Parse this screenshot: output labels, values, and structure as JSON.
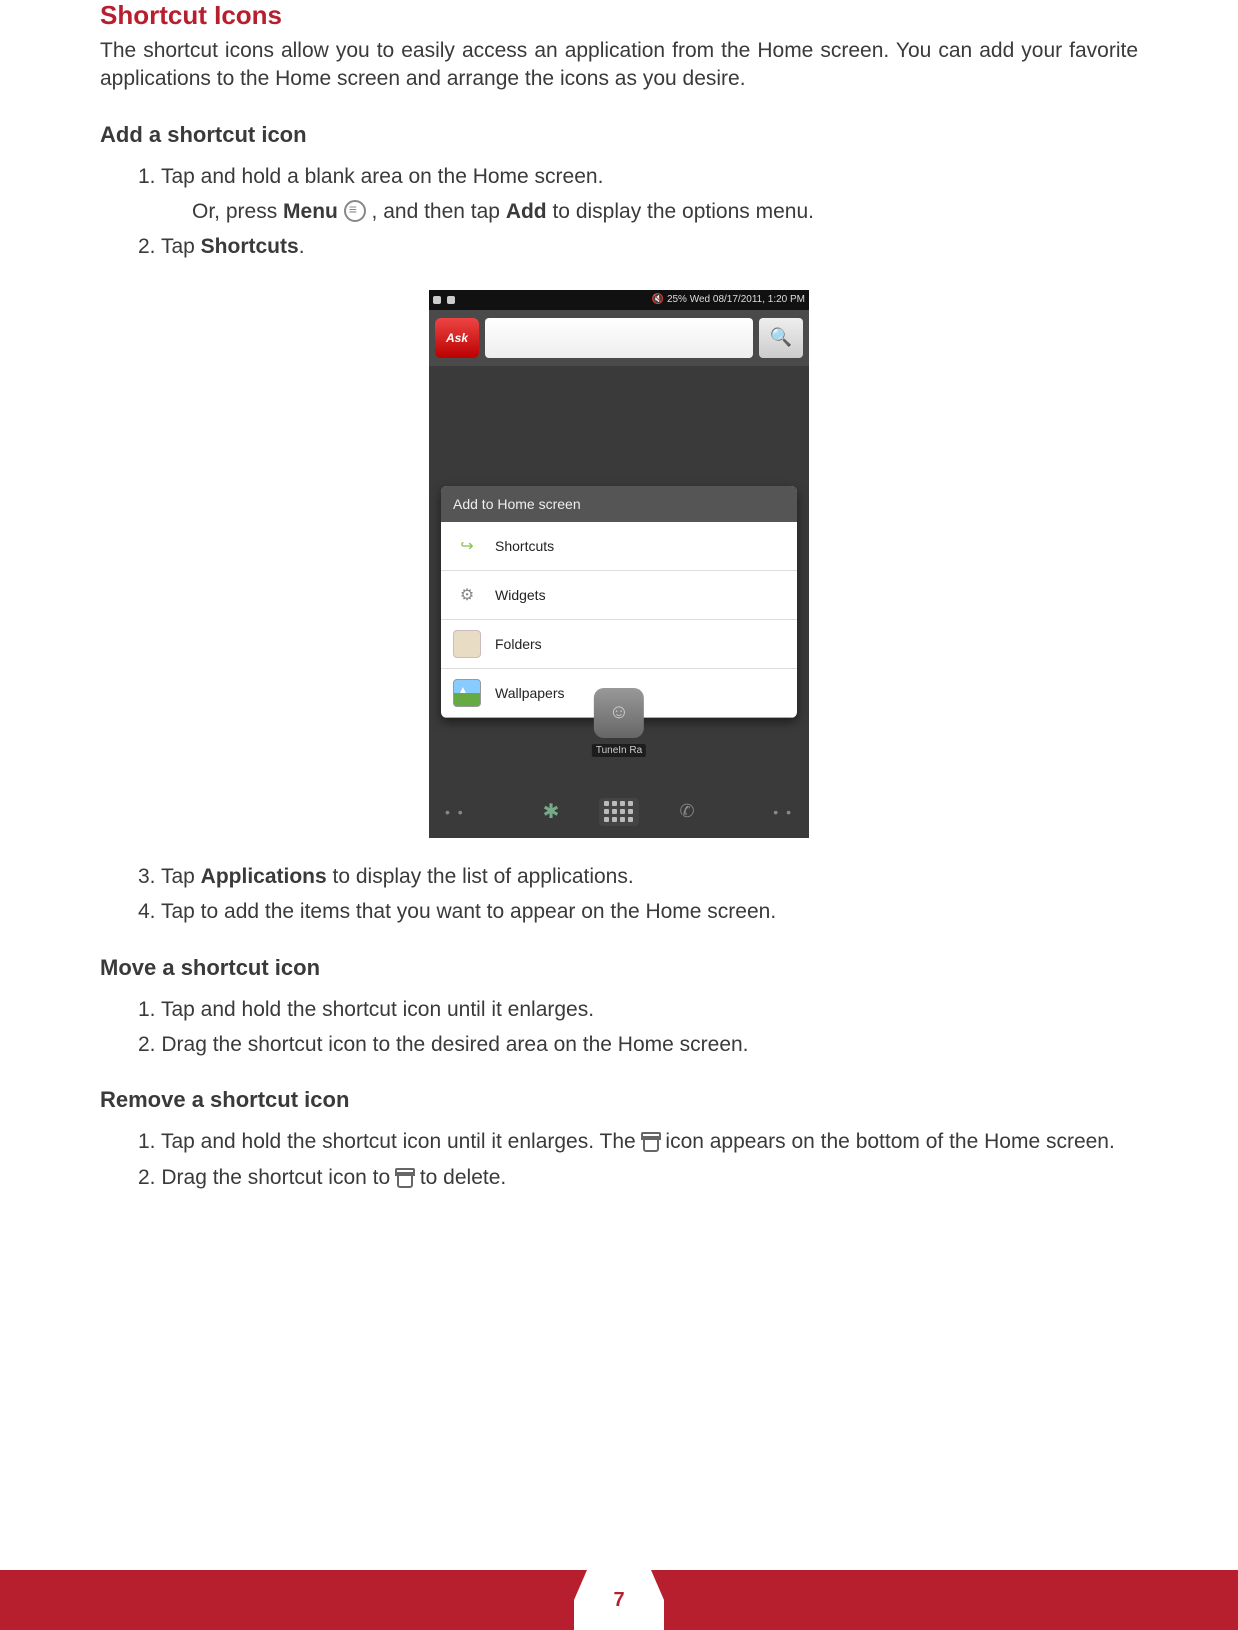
{
  "page_number": "7",
  "heading": "Shortcut Icons",
  "intro": "The shortcut icons allow you to easily access an application from the Home screen. You can add your favorite applications to the Home screen and arrange the icons as you desire.",
  "add": {
    "title": "Add a shortcut icon",
    "step1_num": "1. ",
    "step1": "Tap and hold a blank area on the Home screen.",
    "step1b_pre": "Or, press ",
    "step1b_bold1": "Menu",
    "step1b_mid": " , and then tap ",
    "step1b_bold2": "Add",
    "step1b_post": " to display the options menu.",
    "step2_num": "2. ",
    "step2_pre": "Tap ",
    "step2_bold": "Shortcuts",
    "step2_post": ".",
    "step3_num": "3. ",
    "step3_pre": "Tap ",
    "step3_bold": "Applications",
    "step3_post": " to display the list of applications.",
    "step4_num": "4. ",
    "step4": "Tap to add the items that you want to appear on the Home screen."
  },
  "move": {
    "title": "Move a shortcut icon",
    "step1_num": "1. ",
    "step1": "Tap and hold the shortcut icon until it enlarges.",
    "step2_num": "2. ",
    "step2": "Drag the shortcut icon to the desired area on the Home screen."
  },
  "remove": {
    "title": "Remove a shortcut icon",
    "step1_num": "1. ",
    "step1_pre": "Tap and hold the shortcut icon until it enlarges. The ",
    "step1_post": " icon appears on the bottom of the Home screen.",
    "step2_num": "2. ",
    "step2_pre": "Drag the shortcut icon to ",
    "step2_post": " to delete."
  },
  "device": {
    "status_right": "25%   Wed 08/17/2011, 1:20 PM",
    "ask": "Ask",
    "dialog_title": "Add to Home screen",
    "items": {
      "shortcuts": "Shortcuts",
      "widgets": "Widgets",
      "folders": "Folders",
      "wallpapers": "Wallpapers"
    },
    "radio_label": "TuneIn Ra"
  }
}
